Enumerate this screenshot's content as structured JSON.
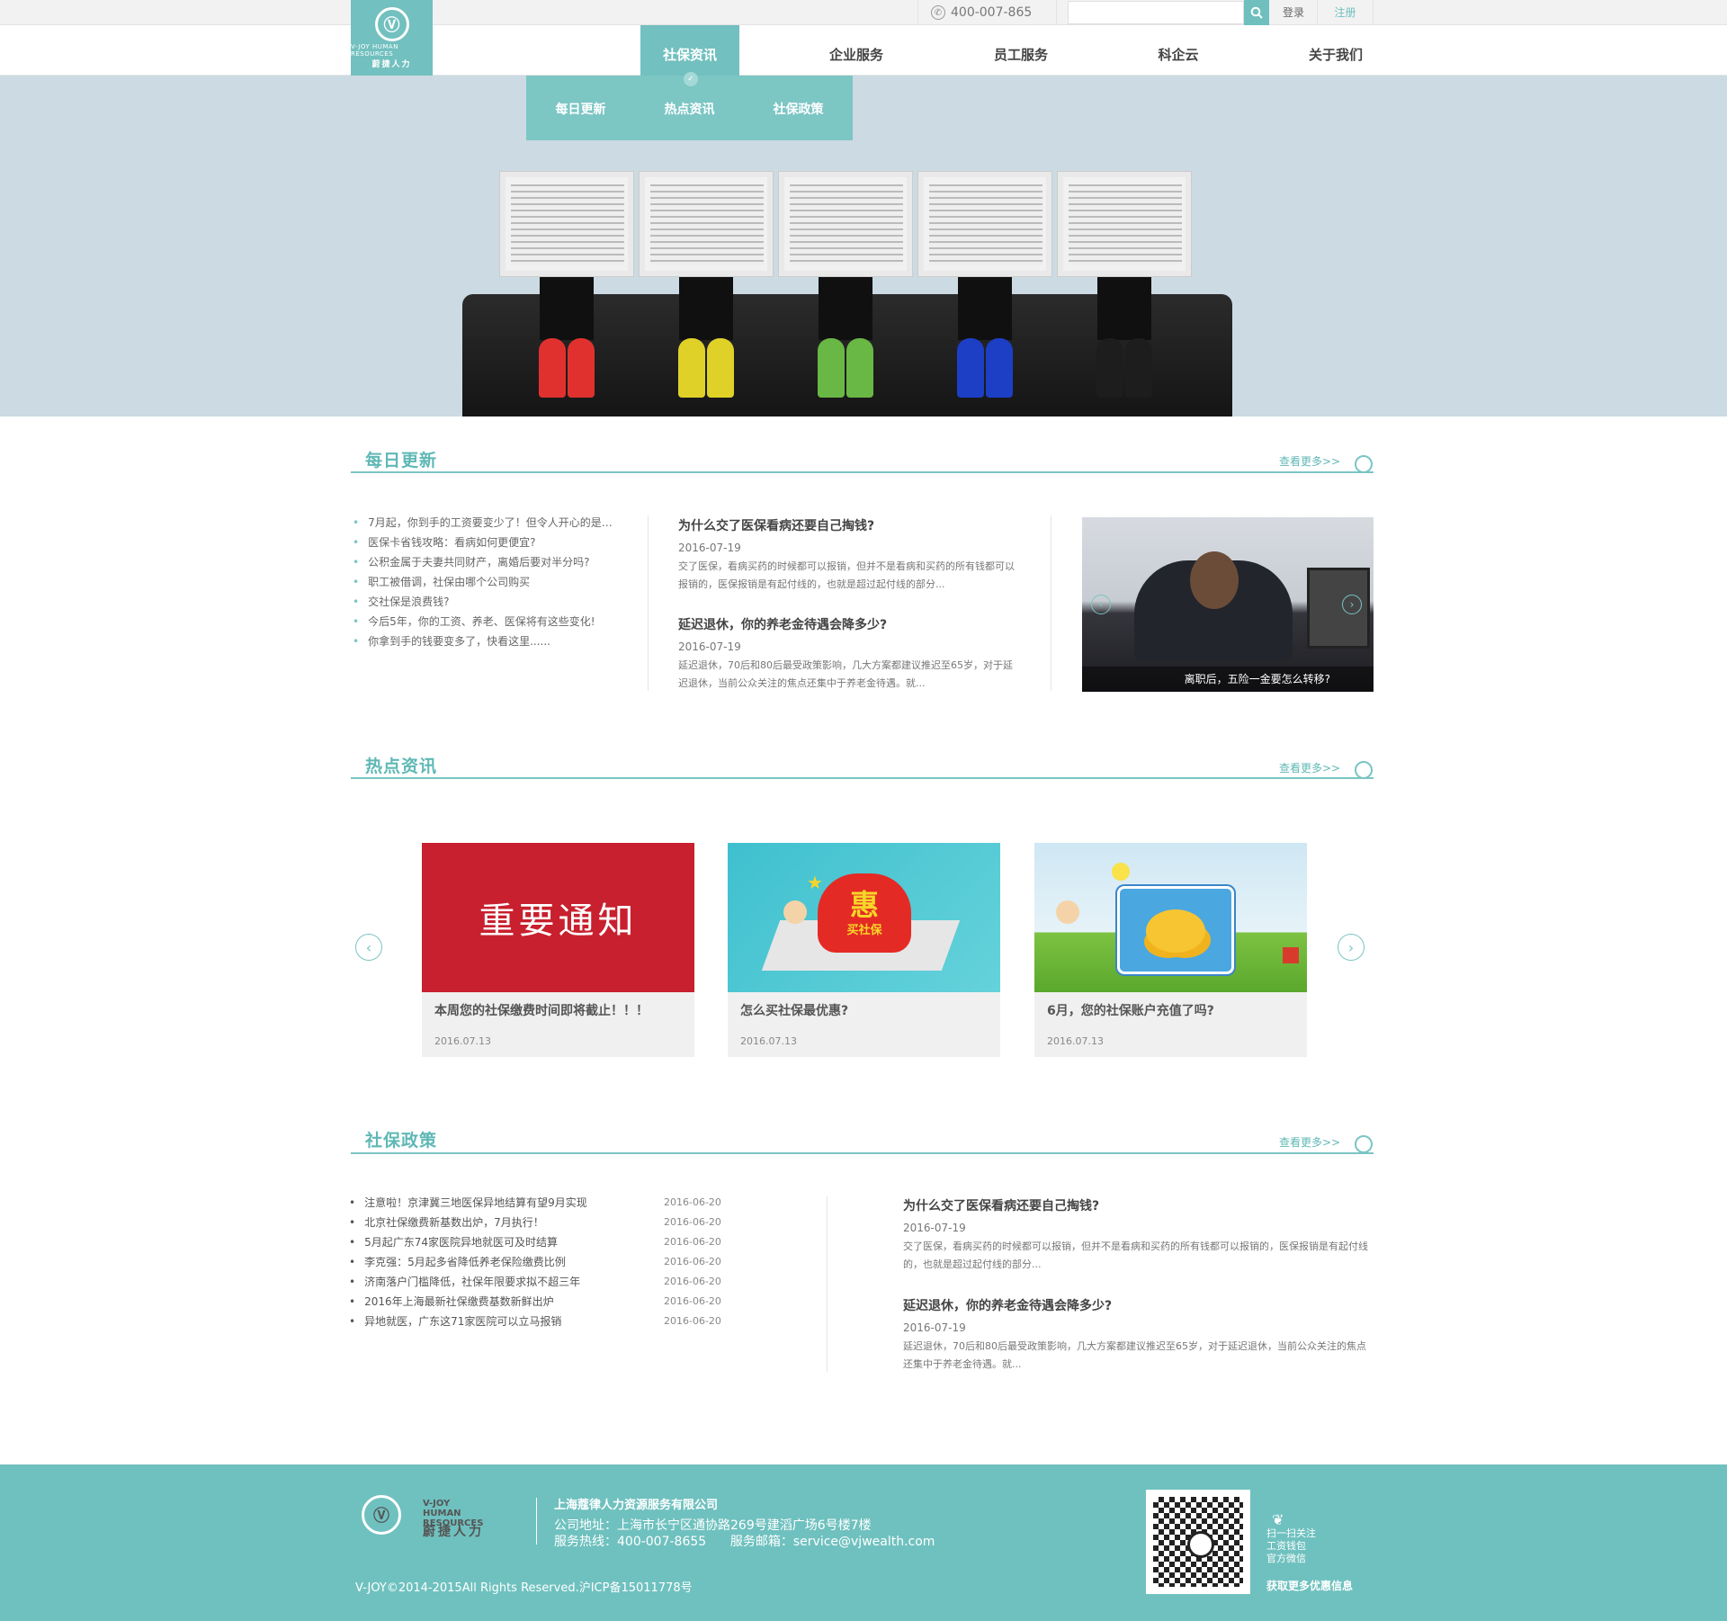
{
  "topbar": {
    "phone": "400-007-865",
    "search_placeholder": "",
    "login": "登录",
    "register": "注册"
  },
  "logo": {
    "en": "V-JOY HUMAN RESOURCES",
    "cn": "蔚捷人力"
  },
  "nav": [
    {
      "label": "社保资讯",
      "active": true
    },
    {
      "label": "企业服务"
    },
    {
      "label": "员工服务"
    },
    {
      "label": "科企云"
    },
    {
      "label": "关于我们"
    }
  ],
  "dropdown": [
    "每日更新",
    "热点资讯",
    "社保政策"
  ],
  "daily": {
    "title": "每日更新",
    "more": "查看更多>>",
    "list": [
      "7月起，你到手的工资要变少了！但令人开心的是…",
      "医保卡省钱攻略：看病如何更便宜?",
      "公积金属于夫妻共同财产，离婚后要对半分吗?",
      "职工被借调，社保由哪个公司购买",
      "交社保是浪费钱?",
      "今后5年，你的工资、养老、医保将有这些变化!",
      "你拿到手的钱要变多了，快看这里......"
    ],
    "articles": [
      {
        "title": "为什么交了医保看病还要自己掏钱?",
        "date": "2016-07-19",
        "body": "交了医保，看病买药的时候都可以报销，但并不是看病和买药的所有钱都可以报销的，医保报销是有起付线的，也就是超过起付线的部分..."
      },
      {
        "title": "延迟退休，你的养老金待遇会降多少?",
        "date": "2016-07-19",
        "body": "延迟退休，70后和80后最受政策影响，几大方案都建议推迟至65岁，对于延迟退休，当前公众关注的焦点还集中于养老金待遇。就..."
      }
    ],
    "slide_caption": "离职后，五险一金要怎么转移?"
  },
  "hot": {
    "title": "热点资讯",
    "more": "查看更多>>",
    "cards": [
      {
        "image_text": "重要通知",
        "title": "本周您的社保缴费时间即将截止！！！",
        "date": "2016.07.13"
      },
      {
        "image_text": "惠",
        "image_sub": "买社保",
        "title": "怎么买社保最优惠?",
        "date": "2016.07.13"
      },
      {
        "title": "6月，您的社保账户充值了吗?",
        "date": "2016.07.13"
      }
    ]
  },
  "policy": {
    "title": "社保政策",
    "more": "查看更多>>",
    "list": [
      {
        "t": "注意啦！京津冀三地医保异地结算有望9月实现",
        "d": "2016-06-20"
      },
      {
        "t": "北京社保缴费新基数出炉，7月执行！",
        "d": "2016-06-20"
      },
      {
        "t": "5月起广东74家医院异地就医可及时结算",
        "d": "2016-06-20"
      },
      {
        "t": "李克强：5月起多省降低养老保险缴费比例",
        "d": "2016-06-20"
      },
      {
        "t": "济南落户门槛降低，社保年限要求拟不超三年",
        "d": "2016-06-20"
      },
      {
        "t": "2016年上海最新社保缴费基数新鲜出炉",
        "d": "2016-06-20"
      },
      {
        "t": "异地就医，广东这71家医院可以立马报销",
        "d": "2016-06-20"
      }
    ],
    "articles": [
      {
        "title": "为什么交了医保看病还要自己掏钱?",
        "date": "2016-07-19",
        "body": "交了医保，看病买药的时候都可以报销，但并不是看病和买药的所有钱都可以报销的，医保报销是有起付线的，也就是超过起付线的部分..."
      },
      {
        "title": "延迟退休，你的养老金待遇会降多少?",
        "date": "2016-07-19",
        "body": "延迟退休，70后和80后最受政策影响，几大方案都建议推迟至65岁，对于延迟退休，当前公众关注的焦点还集中于养老金待遇。就..."
      }
    ]
  },
  "footer": {
    "logo_en1": "V-JOY",
    "logo_en2": "HUMAN RESOURCES",
    "logo_cn": "蔚捷人力",
    "company": "上海蔻律人力资源服务有限公司",
    "address": "公司地址：上海市长宁区通协路269号建滔广场6号楼7楼",
    "contact": "服务热线：400-007-8655      服务邮箱：service@vjwealth.com",
    "copyright": "V-JOY©2014-2015All Rights Reserved.沪ICP备15011778号",
    "qr_lines": [
      "扫一扫关注",
      "工资钱包",
      "官方微信"
    ],
    "qr_cta": "获取更多优惠信息"
  },
  "colors": {
    "accent": "#6fc1bf",
    "notice_red": "#c8202e",
    "banner_bg": "#cbdae3"
  },
  "icons": {
    "phone": "phone-icon",
    "search": "search-icon",
    "prev": "chevron-left-icon",
    "next": "chevron-right-icon"
  }
}
